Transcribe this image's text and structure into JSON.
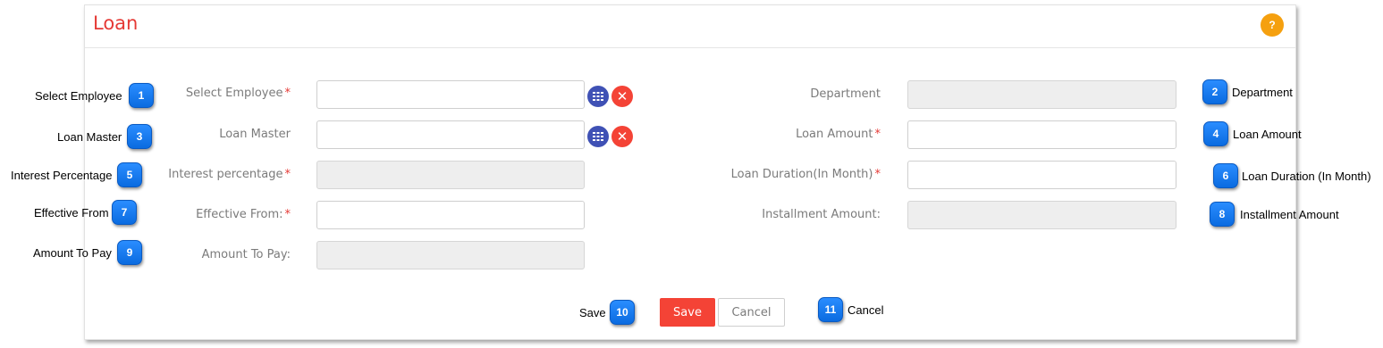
{
  "panel": {
    "title": "Loan",
    "help_label": "?"
  },
  "form": {
    "select_employee": {
      "label": "Select Employee",
      "required": "*",
      "value": ""
    },
    "loan_master": {
      "label": "Loan Master",
      "value": ""
    },
    "interest_percentage": {
      "label": "Interest percentage",
      "required": "*",
      "value": ""
    },
    "effective_from": {
      "label": "Effective From:",
      "required": "*",
      "value": ""
    },
    "amount_to_pay": {
      "label": "Amount To Pay:",
      "value": ""
    },
    "department": {
      "label": "Department",
      "value": ""
    },
    "loan_amount": {
      "label": "Loan Amount",
      "required": "*",
      "value": ""
    },
    "loan_duration": {
      "label": "Loan Duration(In Month)",
      "required": "*",
      "value": ""
    },
    "installment_amount": {
      "label": "Installment Amount:",
      "value": ""
    }
  },
  "actions": {
    "save_label": "Save",
    "cancel_label": "Cancel",
    "clear_glyph": "✕"
  },
  "callouts": [
    {
      "number": "1",
      "text": "Select Employee"
    },
    {
      "number": "2",
      "text": "Department"
    },
    {
      "number": "3",
      "text": "Loan Master"
    },
    {
      "number": "4",
      "text": "Loan Amount"
    },
    {
      "number": "5",
      "text": "Interest Percentage"
    },
    {
      "number": "6",
      "text": "Loan Duration (In Month)"
    },
    {
      "number": "7",
      "text": "Effective From"
    },
    {
      "number": "8",
      "text": "Installment Amount"
    },
    {
      "number": "9",
      "text": "Amount To Pay"
    },
    {
      "number": "10",
      "text": "Save"
    },
    {
      "number": "11",
      "text": "Cancel"
    }
  ],
  "colors": {
    "title": "#e53935",
    "help": "#f5a00f",
    "grid_button": "#3f51b5",
    "clear_button": "#f44336",
    "save_button": "#f44336",
    "badge": "#0a6be0"
  },
  "icons": {
    "help": "question-mark-icon",
    "grid": "grid-icon",
    "clear": "close-icon"
  }
}
